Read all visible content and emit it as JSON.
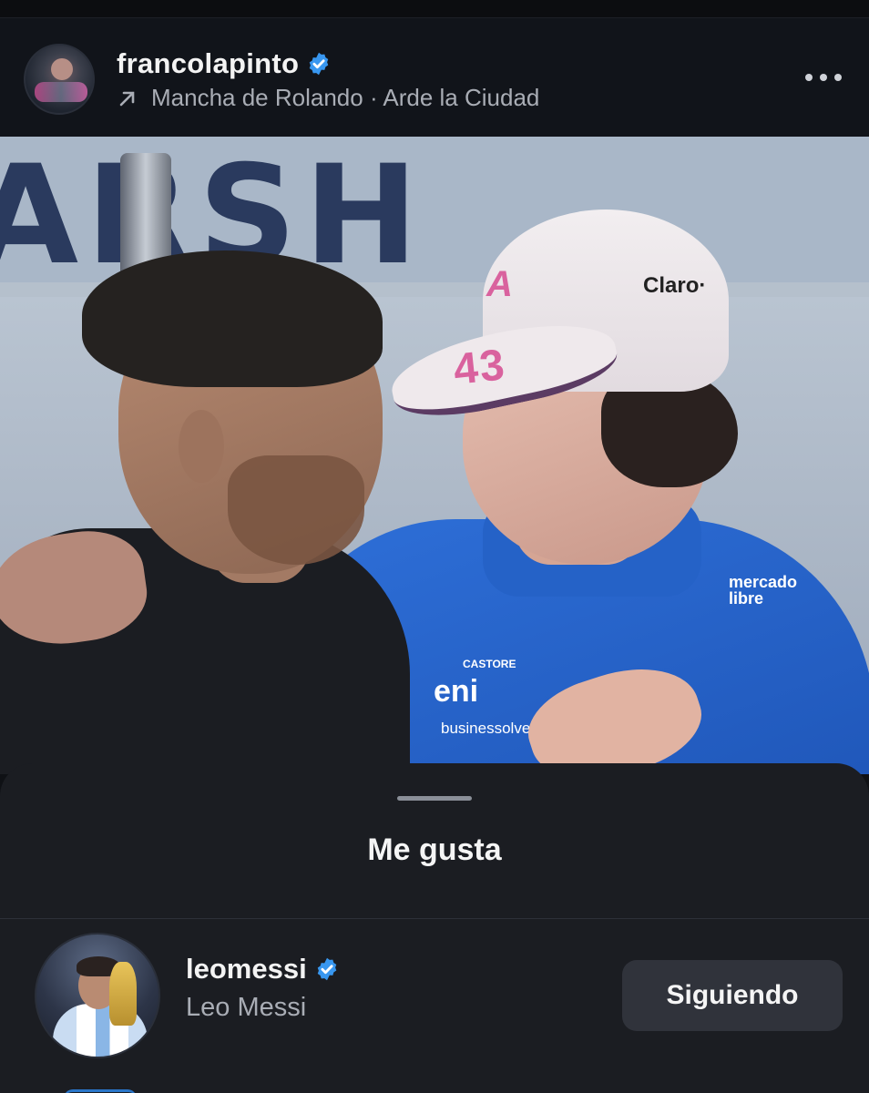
{
  "post": {
    "username": "francolapinto",
    "verified": true,
    "location_music": "Mancha de Rolando · Arde la Ciudad"
  },
  "photo": {
    "banner_text": "ARSH",
    "cap_number": "43",
    "cap_logo": "A",
    "cap_sponsor": "Claro·",
    "shirt_sponsor_1": "mercado libre",
    "shirt_sponsor_2": "eni",
    "shirt_sponsor_3": "CASTORE",
    "shirt_sponsor_4": "businessolver"
  },
  "likes_sheet": {
    "title": "Me gusta",
    "users": [
      {
        "username": "leomessi",
        "verified": true,
        "full_name": "Leo Messi",
        "follow_label": "Siguiendo"
      }
    ]
  },
  "icons": {
    "verified": "verified-badge-icon",
    "location": "arrow-up-right-icon",
    "more": "more-horizontal-icon"
  },
  "colors": {
    "background": "#0f1115",
    "sheet": "#1b1d22",
    "verified_blue": "#3897f0",
    "button": "#30333b"
  }
}
